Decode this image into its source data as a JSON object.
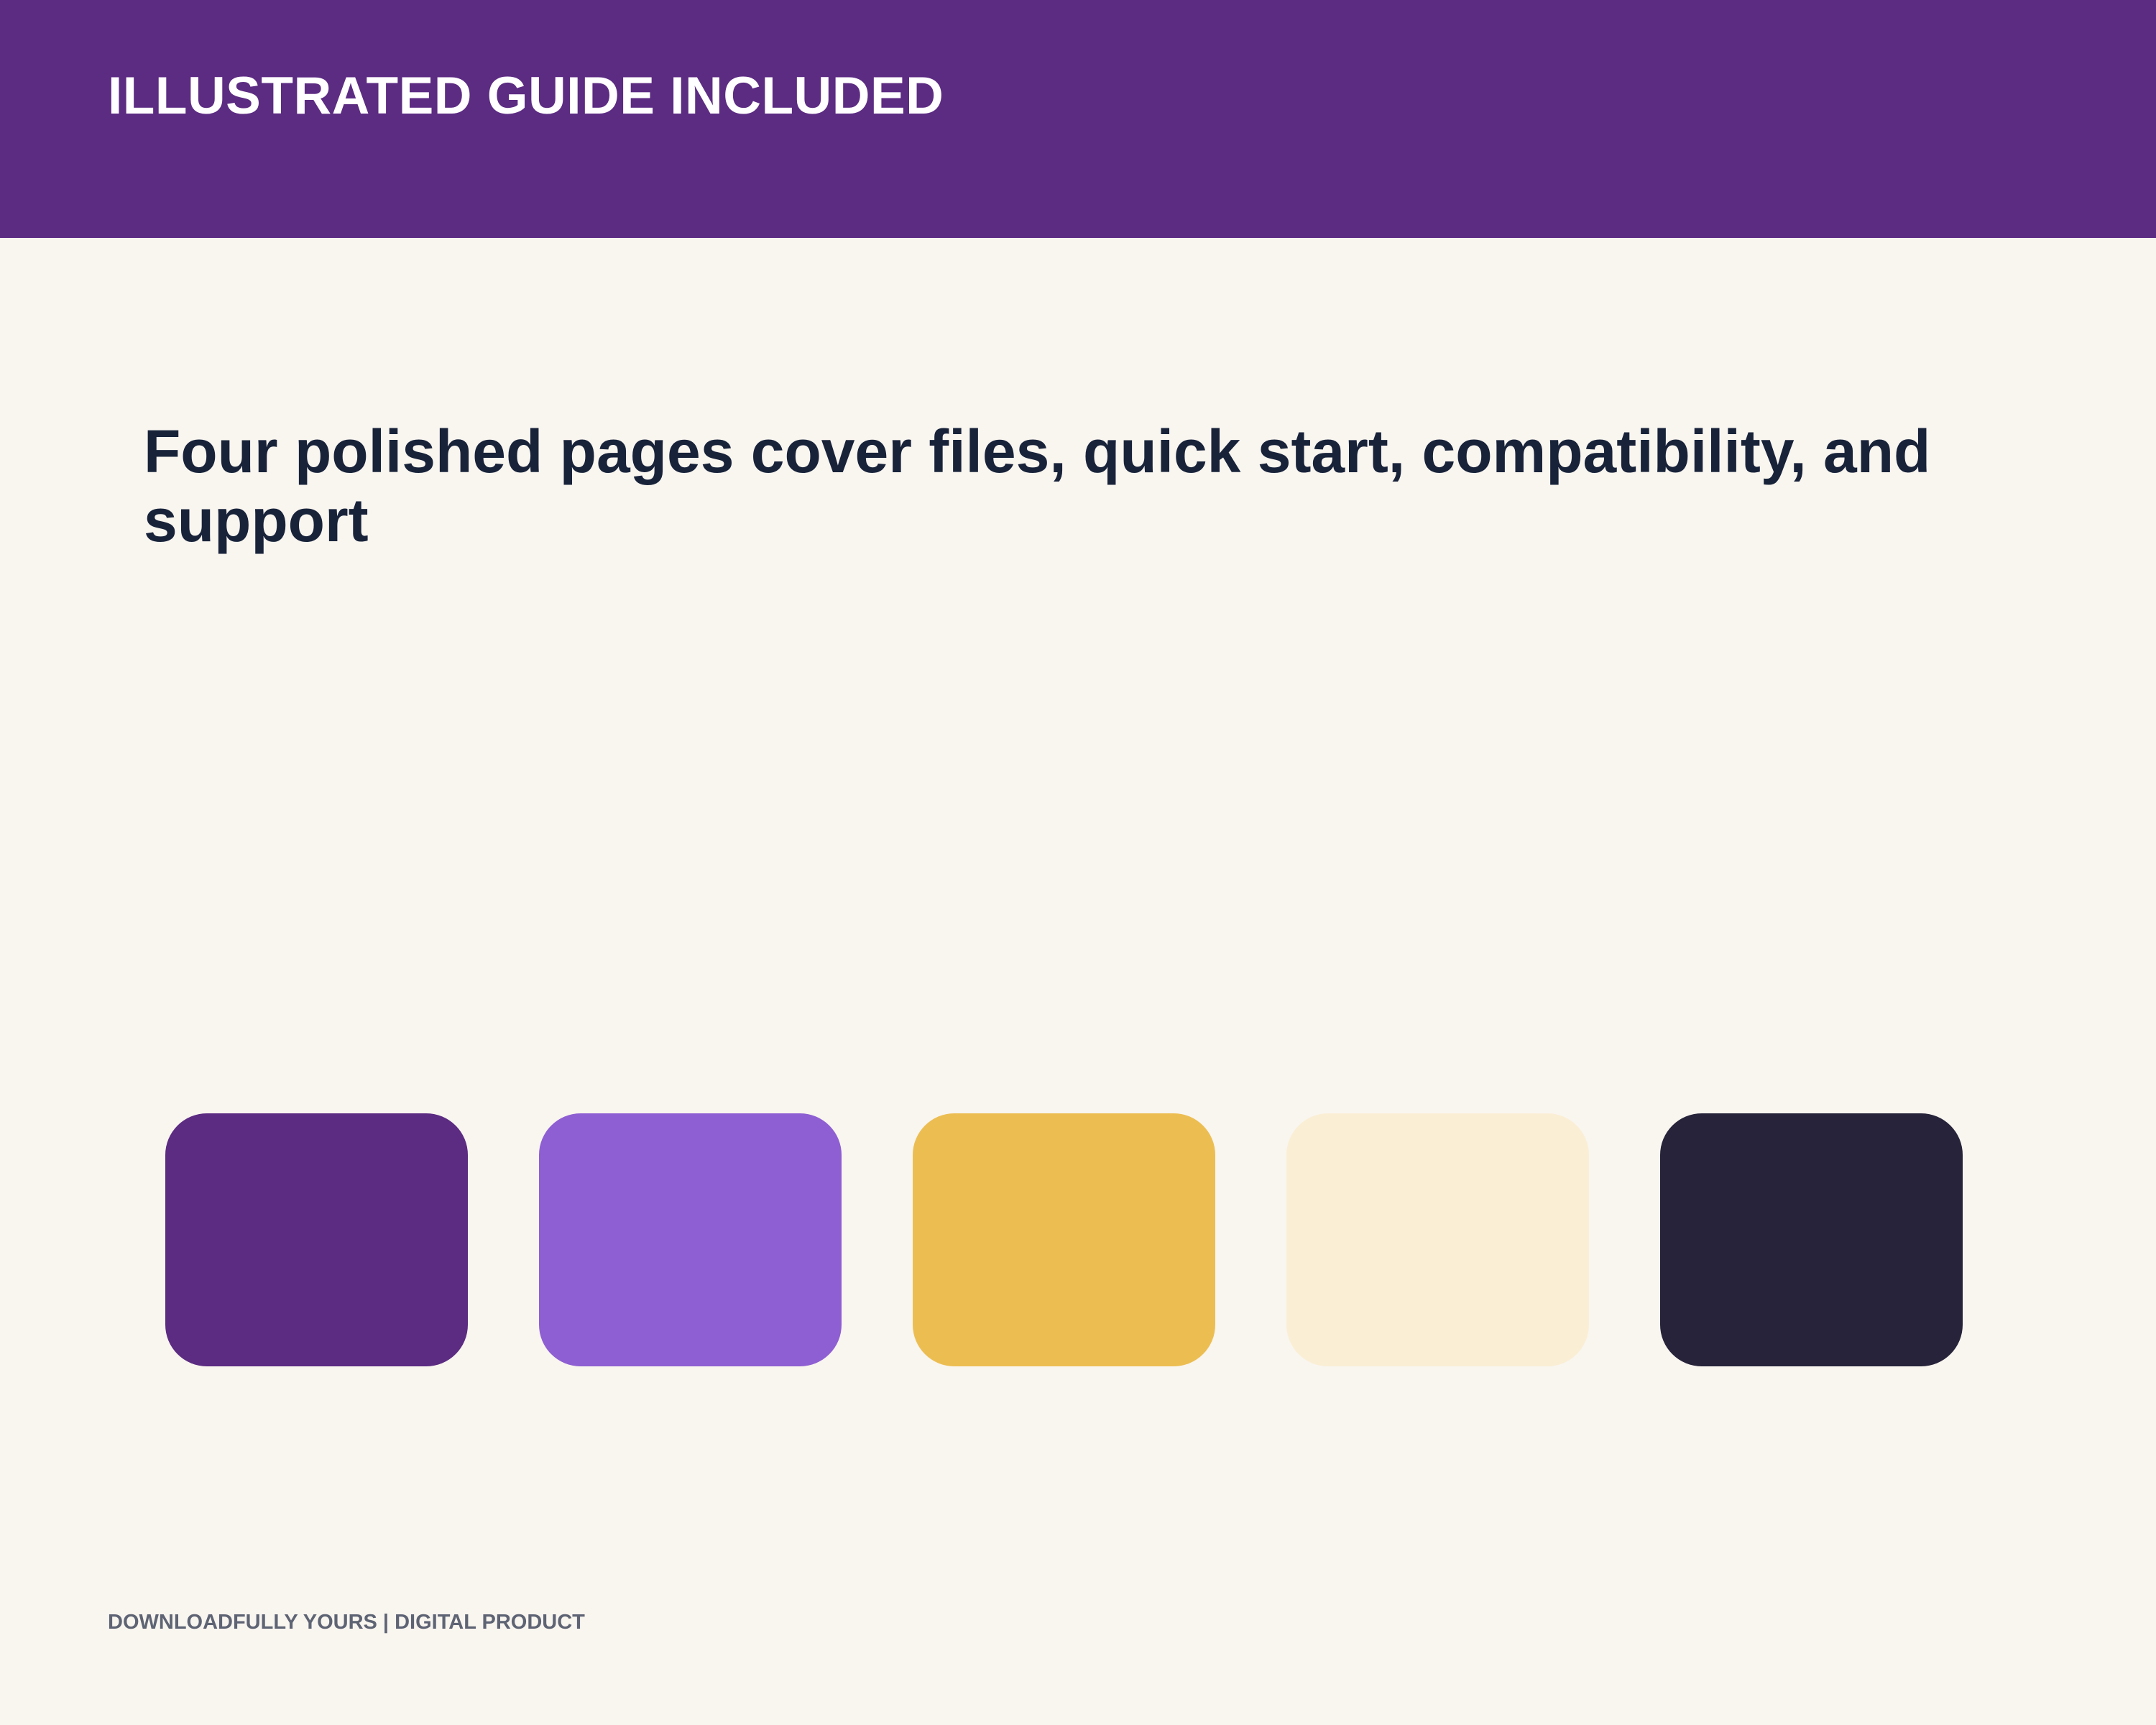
{
  "header": {
    "title": "ILLUSTRATED GUIDE INCLUDED",
    "background_color": "#5c2b82"
  },
  "main": {
    "headline": "Four polished pages cover files, quick start, compatibility, and support"
  },
  "palette": {
    "swatches": [
      {
        "color": "#5c2b82"
      },
      {
        "color": "#8e5fd2"
      },
      {
        "color": "#ecbe52"
      },
      {
        "color": "#faefd5"
      },
      {
        "color": "#26233a"
      }
    ]
  },
  "footer": {
    "text": "DOWNLOADFULLY YOURS | DIGITAL PRODUCT"
  },
  "page": {
    "background_color": "#f9f5ef"
  }
}
